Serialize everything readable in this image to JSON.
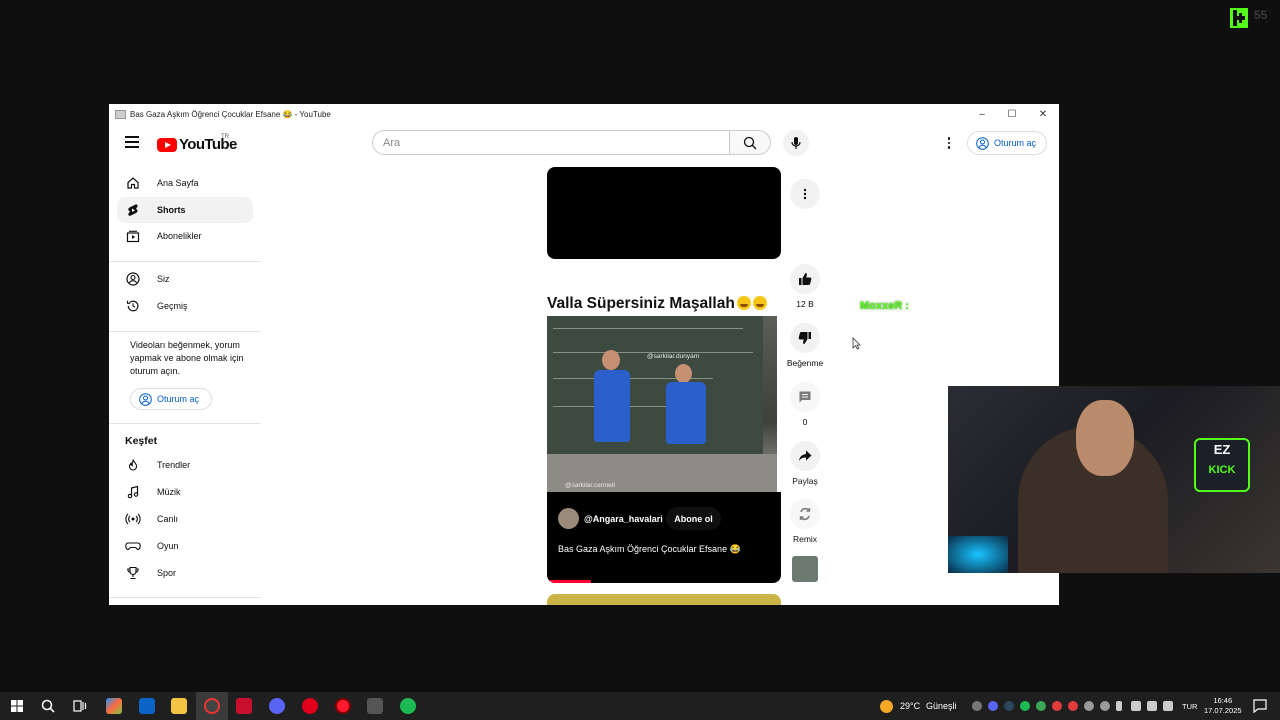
{
  "overlay": {
    "kick_logo": "K",
    "kick_number": "55",
    "chat_user": "MoxxeR",
    "chat_sep": ":"
  },
  "window": {
    "title": "Bas Gaza Aşkım Öğrenci Çocuklar Efsane 😂 - YouTube",
    "minimize": "–",
    "maximize": "☐",
    "close": "✕"
  },
  "header": {
    "logo_text": "YouTube",
    "region": "TR",
    "search_placeholder": "Ara",
    "signin_label": "Oturum aç"
  },
  "sidebar": {
    "main_items": [
      {
        "label": "Ana Sayfa",
        "icon": "home-icon"
      },
      {
        "label": "Shorts",
        "icon": "shorts-icon",
        "active": true
      },
      {
        "label": "Abonelikler",
        "icon": "subscriptions-icon"
      }
    ],
    "you_items": [
      {
        "label": "Siz",
        "icon": "user-icon"
      },
      {
        "label": "Geçmiş",
        "icon": "history-icon"
      }
    ],
    "signin_prompt": "Videoları beğenmek, yorum yapmak ve abone olmak için oturum açın.",
    "signin_label": "Oturum aç",
    "explore_title": "Keşfet",
    "explore_items": [
      {
        "label": "Trendler",
        "icon": "trending-icon"
      },
      {
        "label": "Müzik",
        "icon": "music-icon"
      },
      {
        "label": "Canlı",
        "icon": "live-icon"
      },
      {
        "label": "Oyun",
        "icon": "gaming-icon"
      },
      {
        "label": "Spor",
        "icon": "trophy-icon"
      }
    ]
  },
  "short": {
    "caption_title": "Valla Süpersiniz Maşallah",
    "watermark_top": "@sarkilar.dunyam",
    "watermark_bottom": "@sarkilar.cenneti",
    "channel_handle": "@Angara_havalari",
    "subscribe_label": "Abone ol",
    "video_title": "Bas Gaza Aşkım Öğrenci Çocuklar Efsane 😂"
  },
  "actions": {
    "like_count": "12 B",
    "dislike_label": "Beğenme",
    "comment_count": "0",
    "share_label": "Paylaş",
    "remix_label": "Remix"
  },
  "taskbar": {
    "temperature": "29°C",
    "weather": "Güneşli",
    "language": "TUR",
    "time": "16:46",
    "date": "17.07.2025"
  }
}
